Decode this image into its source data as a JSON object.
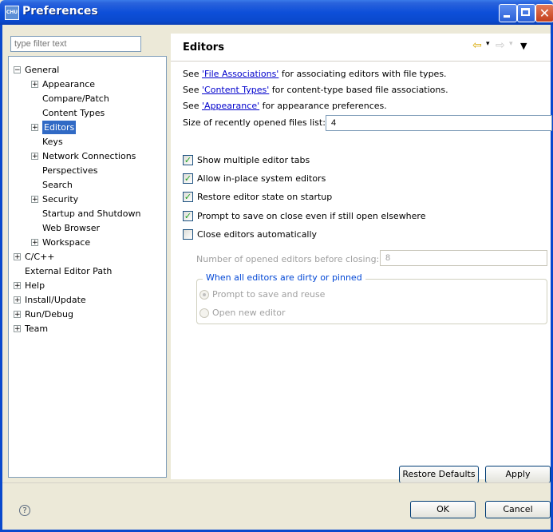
{
  "window": {
    "title": "Preferences",
    "icon_label": "CHU"
  },
  "filter": {
    "placeholder": "type filter text"
  },
  "tree": [
    {
      "label": "General",
      "indent": 0,
      "expander": "−"
    },
    {
      "label": "Appearance",
      "indent": 1,
      "expander": "+"
    },
    {
      "label": "Compare/Patch",
      "indent": 1,
      "expander": ""
    },
    {
      "label": "Content Types",
      "indent": 1,
      "expander": ""
    },
    {
      "label": "Editors",
      "indent": 1,
      "expander": "+",
      "selected": true
    },
    {
      "label": "Keys",
      "indent": 1,
      "expander": ""
    },
    {
      "label": "Network Connections",
      "indent": 1,
      "expander": "+"
    },
    {
      "label": "Perspectives",
      "indent": 1,
      "expander": ""
    },
    {
      "label": "Search",
      "indent": 1,
      "expander": ""
    },
    {
      "label": "Security",
      "indent": 1,
      "expander": "+"
    },
    {
      "label": "Startup and Shutdown",
      "indent": 1,
      "expander": ""
    },
    {
      "label": "Web Browser",
      "indent": 1,
      "expander": ""
    },
    {
      "label": "Workspace",
      "indent": 1,
      "expander": "+"
    },
    {
      "label": "C/C++",
      "indent": 0,
      "expander": "+"
    },
    {
      "label": "External Editor Path",
      "indent": 0,
      "expander": ""
    },
    {
      "label": "Help",
      "indent": 0,
      "expander": "+"
    },
    {
      "label": "Install/Update",
      "indent": 0,
      "expander": "+"
    },
    {
      "label": "Run/Debug",
      "indent": 0,
      "expander": "+"
    },
    {
      "label": "Team",
      "indent": 0,
      "expander": "+"
    }
  ],
  "panel": {
    "title": "Editors",
    "see_prefix": "See ",
    "lines": [
      {
        "link": "'File Associations'",
        "rest": " for associating editors with file types."
      },
      {
        "link": "'Content Types'",
        "rest": " for content-type based file associations."
      },
      {
        "link": "'Appearance'",
        "rest": " for appearance preferences."
      }
    ],
    "size_label": "Size of recently opened files list:",
    "size_value": "4",
    "checkboxes": [
      {
        "label": "Show multiple editor tabs",
        "checked": true
      },
      {
        "label": "Allow in-place system editors",
        "checked": true
      },
      {
        "label": "Restore editor state on startup",
        "checked": true
      },
      {
        "label": "Prompt to save on close even if still open elsewhere",
        "checked": true
      },
      {
        "label": "Close editors automatically",
        "checked": false
      }
    ],
    "num_label": "Number of opened editors before closing:",
    "num_value": "8",
    "group_label": "When all editors are dirty or pinned",
    "radios": [
      {
        "label": "Prompt to save and reuse",
        "selected": true
      },
      {
        "label": "Open new editor",
        "selected": false
      }
    ],
    "restore_defaults": "Restore Defaults",
    "apply": "Apply"
  },
  "footer": {
    "ok": "OK",
    "cancel": "Cancel",
    "help_glyph": "?"
  },
  "icons": {
    "back": "back-arrow-icon",
    "forward": "forward-arrow-icon",
    "menu": "view-menu-icon"
  },
  "colors": {
    "titlebar": "#0a49cd",
    "selection": "#316ac5",
    "link": "#0000cc",
    "group_label": "#0046d5"
  }
}
